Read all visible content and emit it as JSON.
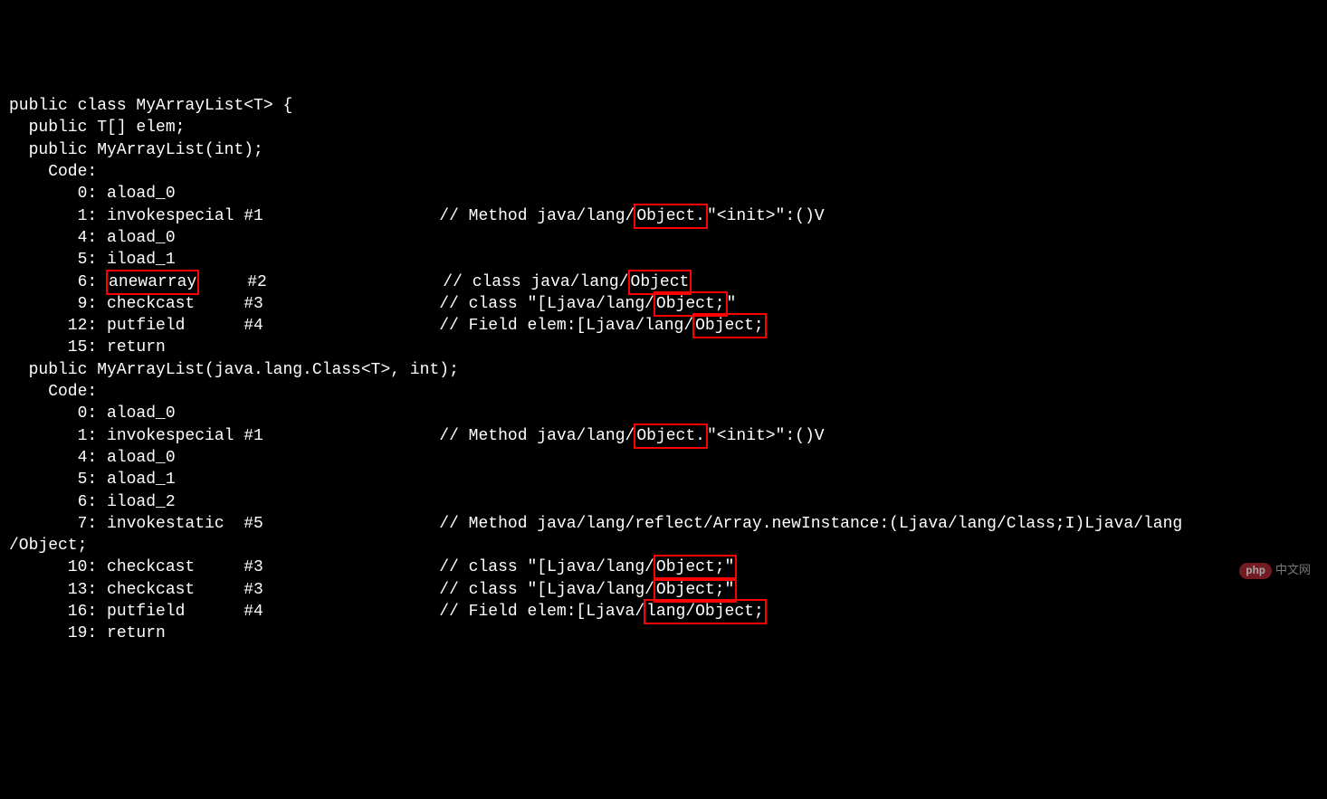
{
  "lines": {
    "l00": "public class MyArrayList<T> {",
    "l01": "  public T[] elem;",
    "blank": "",
    "l02": "  public MyArrayList(int);",
    "l03": "    Code:",
    "l04_a": "       0: aload_0",
    "l05_a": "       1: invokespecial #1                  // Method java/lang/",
    "l05_hl": "Object.",
    "l05_b": "\"<init>\":()V",
    "l06_a": "       4: aload_0",
    "l07_a": "       5: iload_1",
    "l08_a": "       6: ",
    "l08_hl": "anewarray",
    "l08_b": "     #2                  // class java/lang/",
    "l08_hl2": "Object",
    "l09_a": "       9: checkcast     #3                  // class \"[Ljava/lang/",
    "l09_hl": "Object;",
    "l09_b": "\"",
    "l10_a": "      12: putfield      #4                  // Field elem:[Ljava/lang/",
    "l10_hl": "Object;",
    "l11_a": "      15: return",
    "l12": "  public MyArrayList(java.lang.Class<T>, int);",
    "l13": "    Code:",
    "l14": "       0: aload_0",
    "l15_a": "       1: invokespecial #1                  // Method java/lang/",
    "l15_hl": "Object.",
    "l15_b": "\"<init>\":()V",
    "l16": "       4: aload_0",
    "l17": "       5: aload_1",
    "l18": "       6: iload_2",
    "l19": "       7: invokestatic  #5                  // Method java/lang/reflect/Array.newInstance:(Ljava/lang/Class;I)Ljava/lang",
    "l19b": "/Object;",
    "l20_a": "      10: checkcast     #3                  // class \"[Ljava/lang/",
    "l20_hl": "Object;\"",
    "l21_a": "      13: checkcast     #3                  // class \"[Ljava/lang/",
    "l21_hl": "Object;\"",
    "l22_a": "      16: putfield      #4                  // Field elem:[Ljava/",
    "l22_hl": "lang/Object;",
    "l23": "      19: return"
  },
  "watermark": {
    "badge": "php",
    "text": "中文网"
  }
}
